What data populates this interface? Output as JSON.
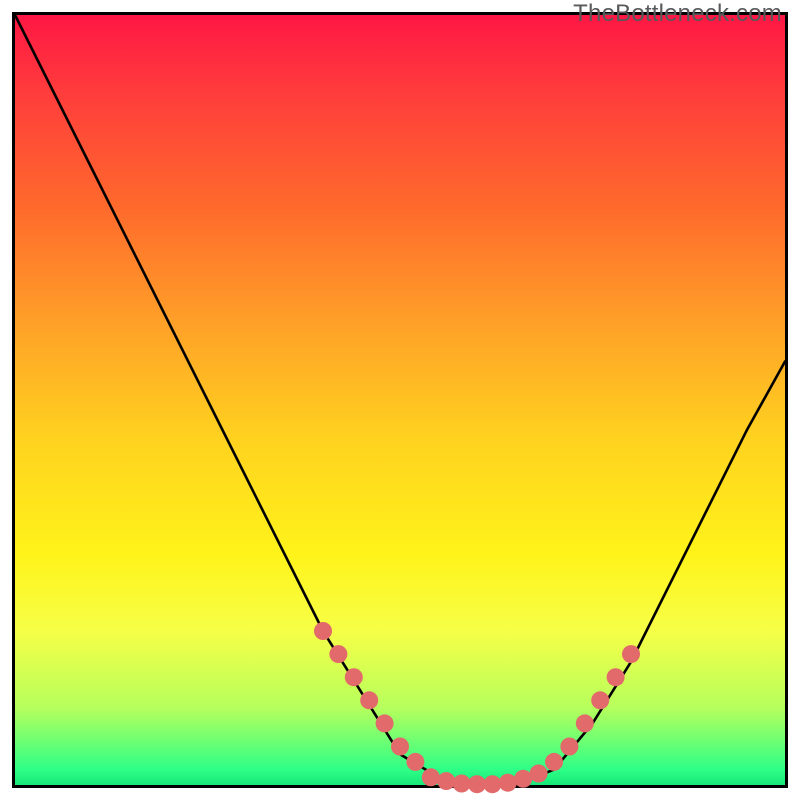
{
  "watermark": "TheBottleneck.com",
  "chart_data": {
    "type": "line",
    "title": "",
    "xlabel": "",
    "ylabel": "",
    "xlim": [
      0,
      100
    ],
    "ylim": [
      0,
      100
    ],
    "grid": false,
    "legend": false,
    "series": [
      {
        "name": "bottleneck-curve",
        "x": [
          0,
          5,
          10,
          15,
          20,
          25,
          30,
          35,
          40,
          45,
          50,
          55,
          60,
          65,
          70,
          75,
          80,
          85,
          90,
          95,
          100
        ],
        "y": [
          100,
          90,
          80,
          70,
          60,
          50,
          40,
          30,
          20,
          12,
          4,
          1,
          0,
          0,
          2,
          8,
          16,
          26,
          36,
          46,
          55
        ]
      }
    ],
    "highlight_segments": [
      {
        "name": "left-valley-highlight",
        "x": [
          40,
          42,
          44,
          46,
          48,
          50,
          52
        ],
        "y": [
          20,
          17,
          14,
          11,
          8,
          5,
          3
        ]
      },
      {
        "name": "bottom-valley-highlight",
        "x": [
          54,
          56,
          58,
          60,
          62,
          64,
          66,
          68
        ],
        "y": [
          1,
          0.5,
          0.2,
          0.1,
          0.1,
          0.3,
          0.8,
          1.5
        ]
      },
      {
        "name": "right-valley-highlight",
        "x": [
          70,
          72,
          74,
          76,
          78,
          80
        ],
        "y": [
          3,
          5,
          8,
          11,
          14,
          17
        ]
      }
    ],
    "dot_style": {
      "color": "#e26a6a",
      "radius": 9
    },
    "curve_style": {
      "color": "#000000",
      "width": 2.6
    }
  }
}
